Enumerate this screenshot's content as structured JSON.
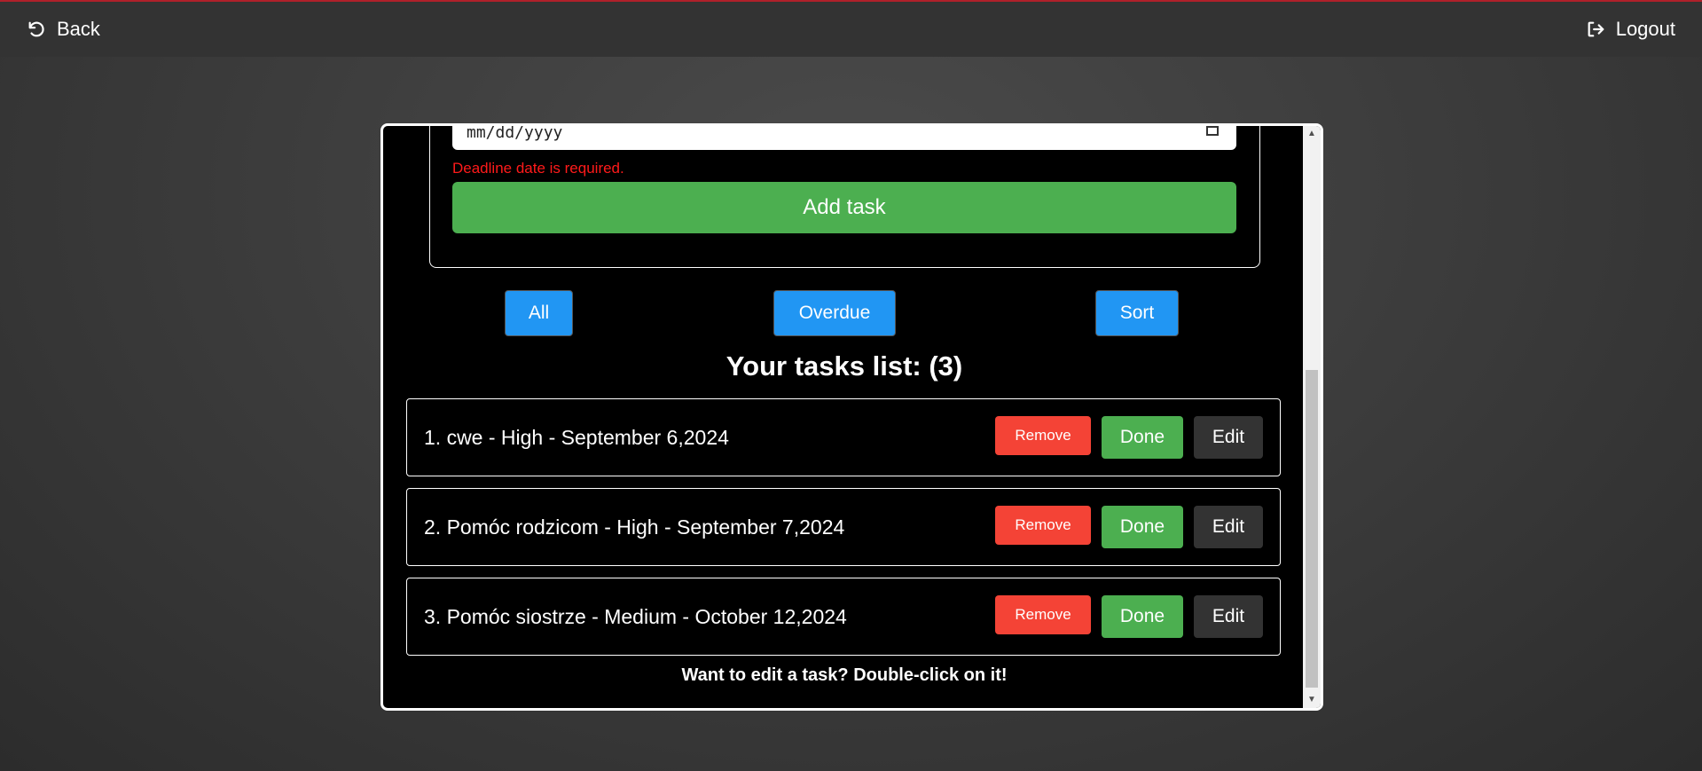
{
  "nav": {
    "back_label": "Back",
    "logout_label": "Logout"
  },
  "form": {
    "date_placeholder": "mm/dd/yyyy",
    "error": "Deadline date is required.",
    "add_button": "Add task"
  },
  "filters": {
    "all": "All",
    "overdue": "Overdue",
    "sort": "Sort"
  },
  "list": {
    "title": "Your tasks list: (3)",
    "items": [
      {
        "text": "1. cwe - High - September 6,2024"
      },
      {
        "text": "2. Pomóc rodzicom - High - September 7,2024"
      },
      {
        "text": "3. Pomóc siostrze - Medium - October 12,2024"
      }
    ],
    "remove_label": "Remove",
    "done_label": "Done",
    "edit_label": "Edit"
  },
  "hint": "Want to edit a task? Double-click on it!",
  "colors": {
    "accent_green": "#4caf50",
    "accent_blue": "#2196f3",
    "accent_red": "#f44336",
    "error_red": "#ff1a1a",
    "navbar": "#333333"
  }
}
